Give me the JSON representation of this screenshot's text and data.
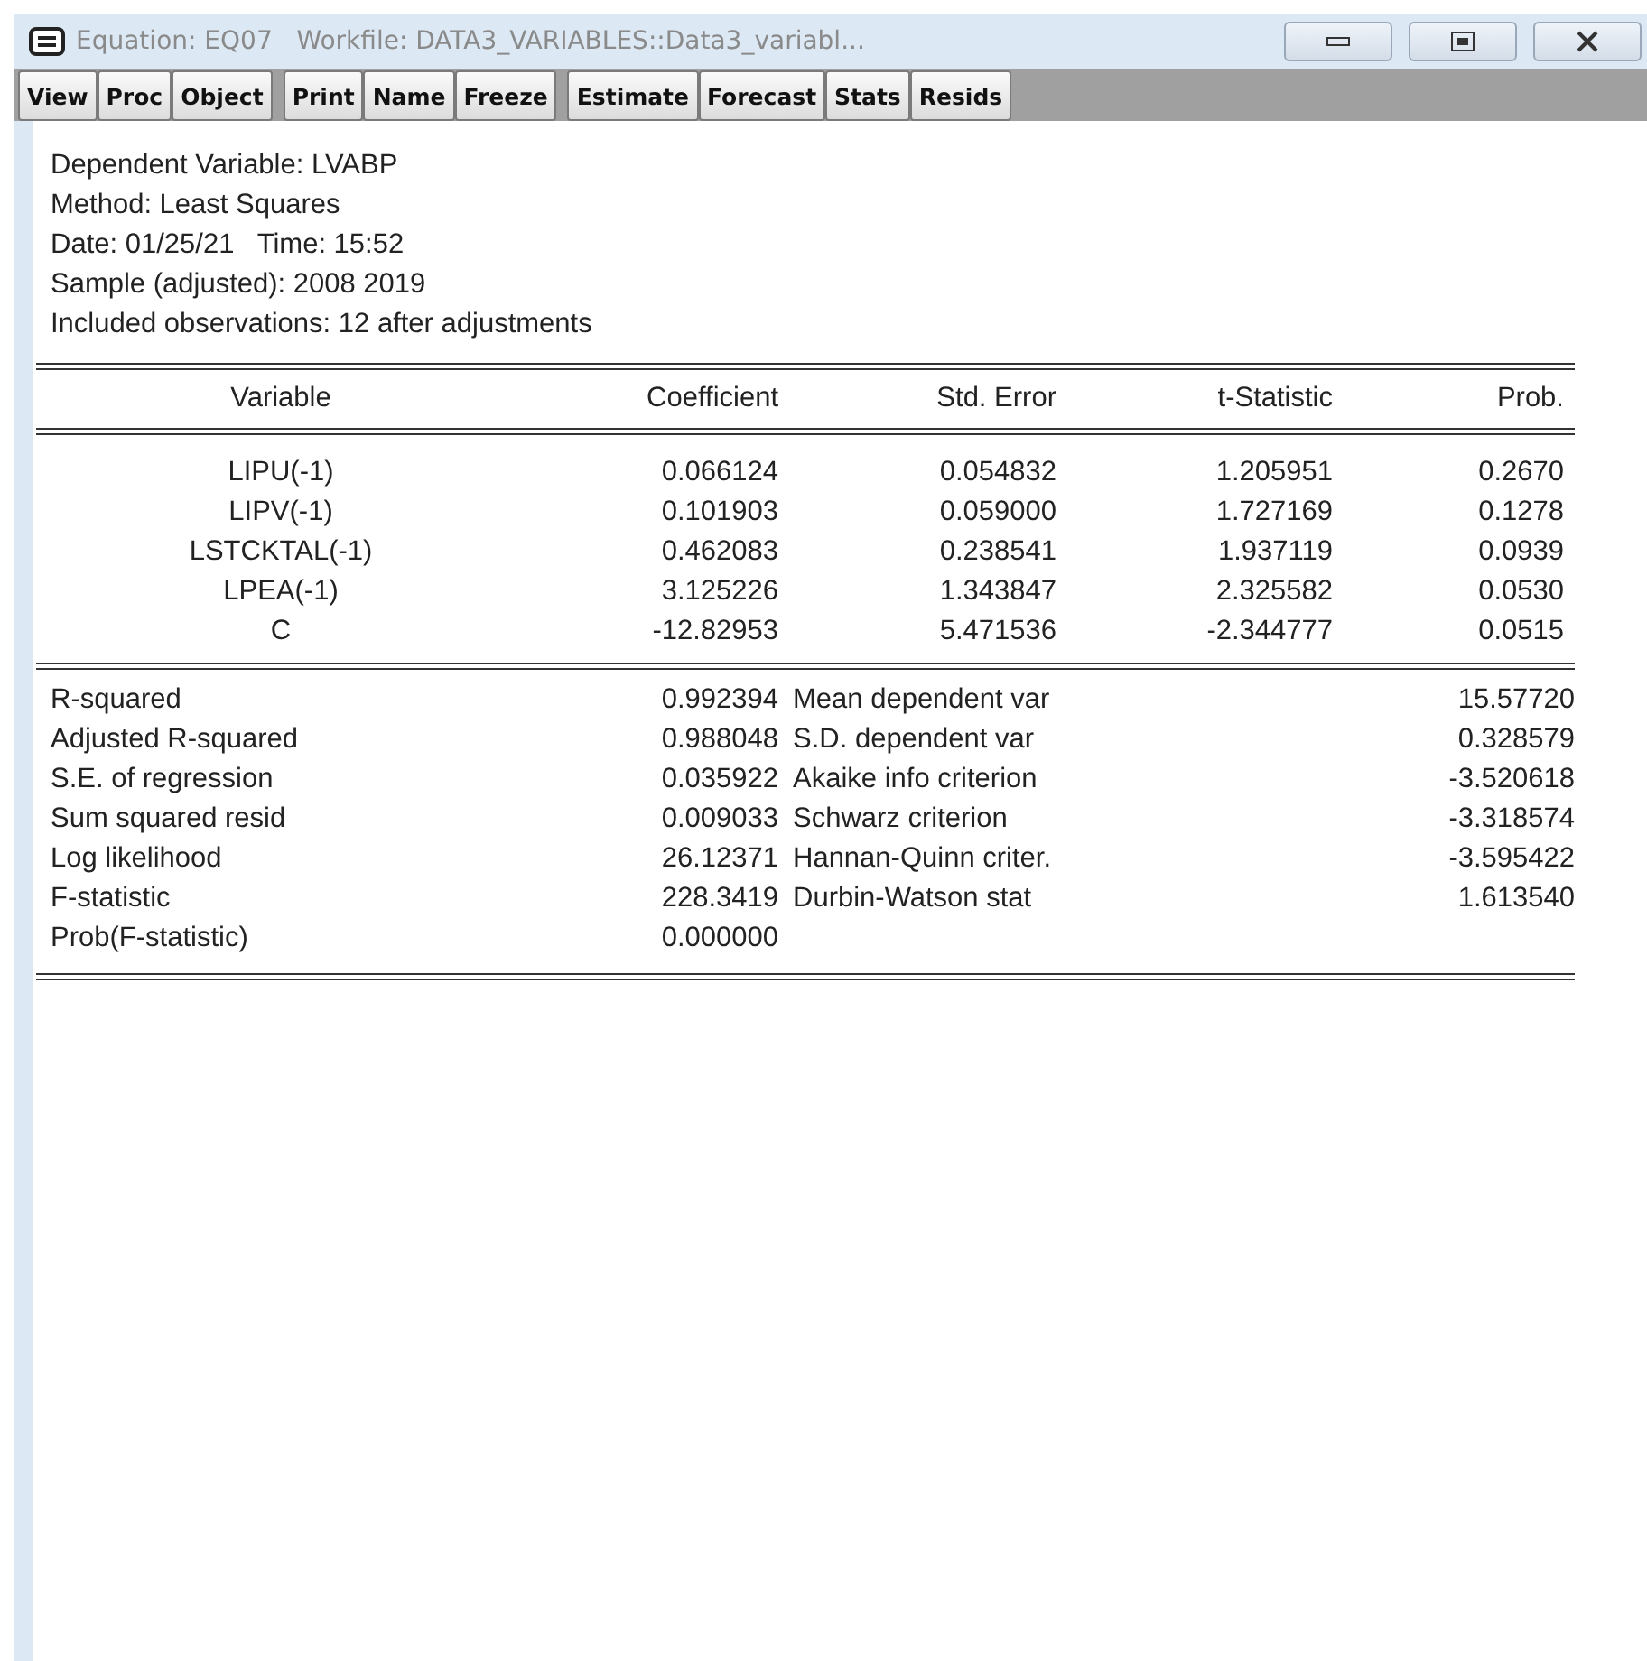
{
  "window": {
    "title": "Equation: EQ07   Workfile: DATA3_VARIABLES::Data3_variabl..."
  },
  "toolbar": [
    [
      "View",
      "Proc",
      "Object"
    ],
    [
      "Print",
      "Name",
      "Freeze"
    ],
    [
      "Estimate",
      "Forecast",
      "Stats",
      "Resids"
    ]
  ],
  "header": [
    "Dependent Variable: LVABP",
    "Method: Least Squares",
    "Date: 01/25/21   Time: 15:52",
    "Sample (adjusted): 2008 2019",
    "Included observations: 12 after adjustments"
  ],
  "table": {
    "columns": [
      "Variable",
      "Coefficient",
      "Std. Error",
      "t-Statistic",
      "Prob."
    ],
    "rows": [
      [
        "LIPU(-1)",
        "0.066124",
        "0.054832",
        "1.205951",
        "0.2670"
      ],
      [
        "LIPV(-1)",
        "0.101903",
        "0.059000",
        "1.727169",
        "0.1278"
      ],
      [
        "LSTCKTAL(-1)",
        "0.462083",
        "0.238541",
        "1.937119",
        "0.0939"
      ],
      [
        "LPEA(-1)",
        "3.125226",
        "1.343847",
        "2.325582",
        "0.0530"
      ],
      [
        "C",
        "-12.82953",
        "5.471536",
        "-2.344777",
        "0.0515"
      ]
    ]
  },
  "stats": [
    [
      "R-squared",
      "0.992394",
      "Mean dependent var",
      "15.57720"
    ],
    [
      "Adjusted R-squared",
      "0.988048",
      "S.D. dependent var",
      "0.328579"
    ],
    [
      "S.E. of regression",
      "0.035922",
      "Akaike info criterion",
      "-3.520618"
    ],
    [
      "Sum squared resid",
      "0.009033",
      "Schwarz criterion",
      "-3.318574"
    ],
    [
      "Log likelihood",
      "26.12371",
      "Hannan-Quinn criter.",
      "-3.595422"
    ],
    [
      "F-statistic",
      "228.3419",
      "Durbin-Watson stat",
      "1.613540"
    ],
    [
      "Prob(F-statistic)",
      "0.000000"
    ]
  ]
}
